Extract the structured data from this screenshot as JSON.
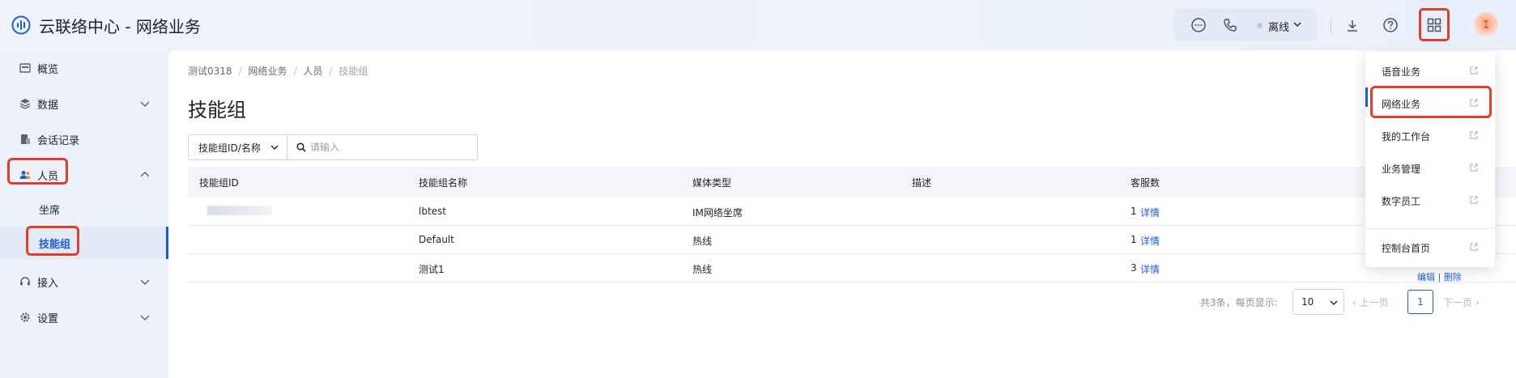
{
  "header": {
    "app_title": "云联络中心 - 网络业务",
    "status_text": "离线",
    "icons": [
      "chat-icon",
      "phone-icon",
      "download-icon",
      "help-icon",
      "apps-grid-icon"
    ]
  },
  "sidebar": {
    "items": [
      {
        "label": "概览",
        "icon": "overview-icon"
      },
      {
        "label": "数据",
        "icon": "layers-icon"
      },
      {
        "label": "会话记录",
        "icon": "record-icon"
      },
      {
        "label": "人员",
        "icon": "people-icon"
      },
      {
        "label": "坐席"
      },
      {
        "label": "技能组"
      },
      {
        "label": "接入",
        "icon": "headset-icon"
      },
      {
        "label": "设置",
        "icon": "settings-icon"
      }
    ]
  },
  "main": {
    "breadcrumb": [
      "测试0318",
      "网络业务",
      "人员",
      "技能组"
    ],
    "page_title": "技能组",
    "filter": {
      "select_label": "技能组ID/名称",
      "search_placeholder": "请输入"
    },
    "table": {
      "columns": [
        "技能组ID",
        "技能组名称",
        "媒体类型",
        "描述",
        "客服数"
      ],
      "rows": [
        {
          "id": "",
          "name": "lbtest",
          "media": "IM网络坐席",
          "desc": "",
          "count": "1",
          "action": "详情"
        },
        {
          "id": "",
          "name": "Default",
          "media": "热线",
          "desc": "",
          "count": "1",
          "action": "详情"
        },
        {
          "id": "",
          "name": "测试1",
          "media": "热线",
          "desc": "",
          "count": "3",
          "action": "详情"
        }
      ],
      "partial_actions": "编辑 | 删除"
    },
    "pagination": {
      "total_text": "共3条，每页显示:",
      "page_size": "10",
      "prev_label": "上一页",
      "current_page": "1",
      "next_label": "下一页"
    }
  },
  "dropdown": {
    "items": [
      "语音业务",
      "网络业务",
      "我的工作台",
      "业务管理",
      "数字员工",
      "控制台首页"
    ]
  },
  "colors": {
    "accent": "#1a5fd8",
    "highlight": "#e0402b",
    "sidebar_bg": "#edf1f8"
  }
}
